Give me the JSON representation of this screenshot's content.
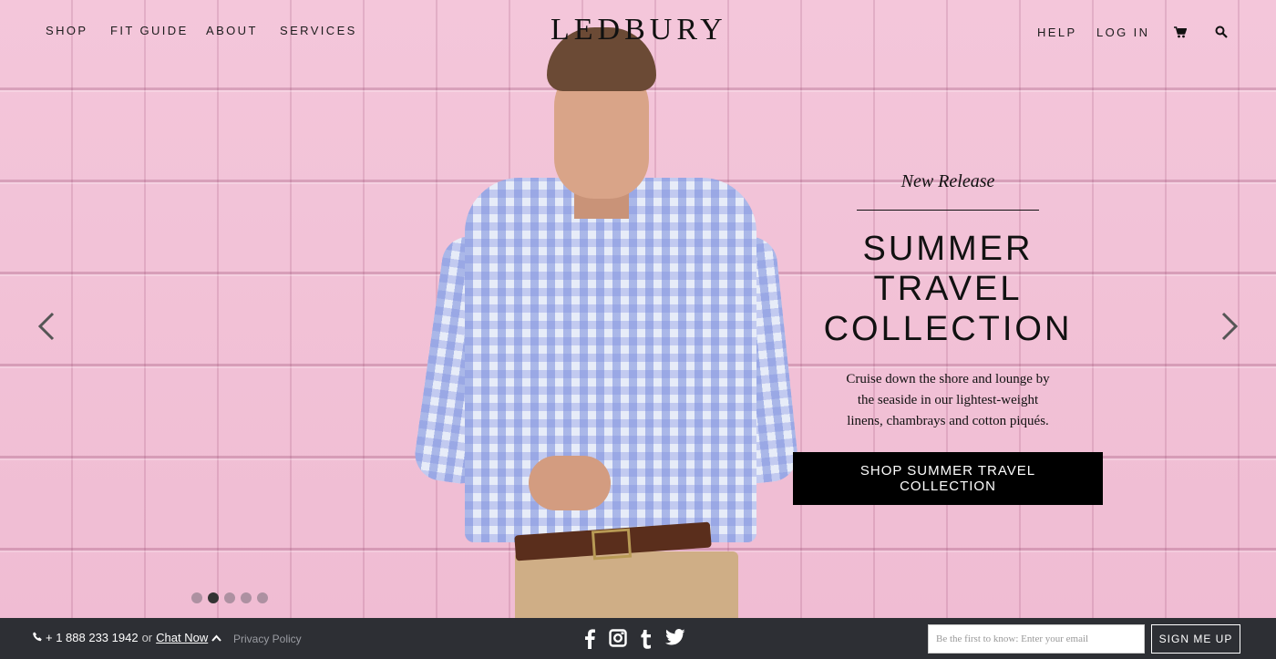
{
  "nav": {
    "left": [
      "SHOP",
      "FIT GUIDE",
      "ABOUT",
      "SERVICES"
    ],
    "logo": "LEDBURY",
    "help": "HELP",
    "login": "LOG IN"
  },
  "promo": {
    "kicker": "New Release",
    "title_line1": "SUMMER TRAVEL",
    "title_line2": "COLLECTION",
    "description": "Cruise down the shore and lounge by the seaside in our lightest-weight linens, chambrays and cotton piqués.",
    "cta": "SHOP SUMMER TRAVEL COLLECTION"
  },
  "carousel": {
    "slide_count": 5,
    "active_slide": 2
  },
  "footer": {
    "phone": "+ 1 888 233 1942",
    "or_text": "or",
    "chat": "Chat Now",
    "privacy": "Privacy Policy",
    "email_placeholder": "Be the first to know: Enter your email",
    "signup": "SIGN ME UP"
  },
  "icons": {
    "cart": "cart-icon",
    "search": "search-icon",
    "prev": "chevron-left-icon",
    "next": "chevron-right-icon",
    "phone": "phone-icon",
    "social": [
      "facebook-icon",
      "instagram-icon",
      "tumblr-icon",
      "twitter-icon"
    ]
  },
  "colors": {
    "hero_background": "#f3c3d8",
    "footer_background": "#2d2f34",
    "cta_background": "#000000"
  }
}
